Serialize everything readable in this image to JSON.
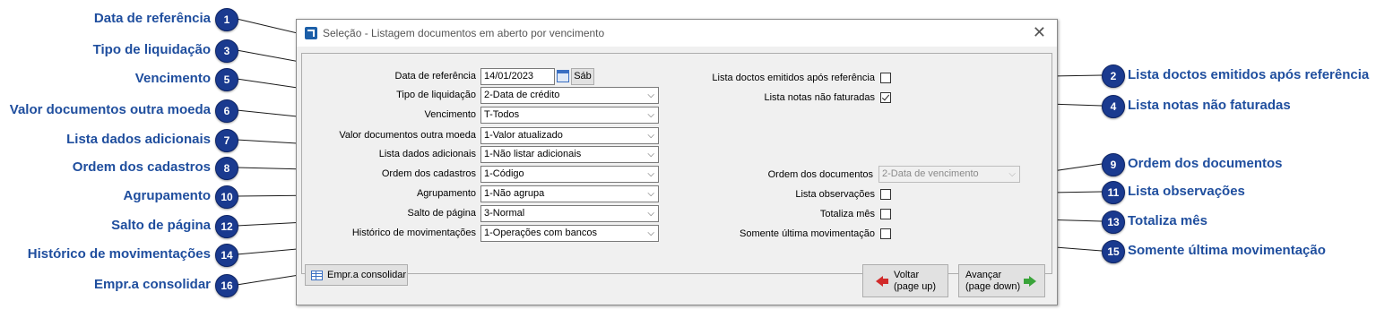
{
  "window": {
    "title": "Seleção - Listagem documentos em aberto por vencimento",
    "close_glyph": "✕"
  },
  "fields": {
    "data_referencia": {
      "label": "Data de referência",
      "value": "14/01/2023",
      "day_button": "Sáb"
    },
    "tipo_liquidacao": {
      "label": "Tipo de liquidação",
      "value": "2-Data de crédito"
    },
    "vencimento": {
      "label": "Vencimento",
      "value": "T-Todos"
    },
    "valor_outra_moeda": {
      "label": "Valor documentos outra moeda",
      "value": "1-Valor atualizado"
    },
    "lista_dados_adicionais": {
      "label": "Lista dados adicionais",
      "value": "1-Não listar adicionais"
    },
    "ordem_cadastros": {
      "label": "Ordem dos cadastros",
      "value": "1-Código"
    },
    "agrupamento": {
      "label": "Agrupamento",
      "value": "1-Não agrupa"
    },
    "salto_pagina": {
      "label": "Salto de página",
      "value": "3-Normal"
    },
    "historico_movimentacoes": {
      "label": "Histórico de movimentações",
      "value": "1-Operações com bancos"
    },
    "lista_doctos_emitidos": {
      "label": "Lista doctos emitidos após referência",
      "checked": false
    },
    "lista_notas_nao_faturadas": {
      "label": "Lista notas não faturadas",
      "checked": true
    },
    "ordem_documentos": {
      "label": "Ordem dos documentos",
      "value": "2-Data de vencimento",
      "disabled": true
    },
    "lista_observacoes": {
      "label": "Lista observações",
      "checked": false
    },
    "totaliza_mes": {
      "label": "Totaliza mês",
      "checked": false
    },
    "somente_ultima_mov": {
      "label": "Somente última movimentação",
      "checked": false
    }
  },
  "buttons": {
    "empr_consolidar": "Empr.a consolidar",
    "voltar_line1": "Voltar",
    "voltar_line2": "(page up)",
    "avancar_line1": "Avançar",
    "avancar_line2": "(page down)"
  },
  "callouts": [
    {
      "num": "1",
      "text": "Data de referência"
    },
    {
      "num": "2",
      "text": "Lista doctos emitidos após referência"
    },
    {
      "num": "3",
      "text": "Tipo de liquidação"
    },
    {
      "num": "4",
      "text": "Lista notas não faturadas"
    },
    {
      "num": "5",
      "text": "Vencimento"
    },
    {
      "num": "6",
      "text": "Valor documentos outra moeda"
    },
    {
      "num": "7",
      "text": "Lista dados adicionais"
    },
    {
      "num": "8",
      "text": "Ordem dos cadastros"
    },
    {
      "num": "9",
      "text": "Ordem dos documentos"
    },
    {
      "num": "10",
      "text": "Agrupamento"
    },
    {
      "num": "11",
      "text": "Lista observações"
    },
    {
      "num": "12",
      "text": "Salto de página"
    },
    {
      "num": "13",
      "text": "Totaliza mês"
    },
    {
      "num": "14",
      "text": "Histórico de movimentações"
    },
    {
      "num": "15",
      "text": "Somente última movimentação"
    },
    {
      "num": "16",
      "text": "Empr.a consolidar"
    }
  ],
  "colors": {
    "callout_text": "#1f4e9e",
    "badge": "#1a3a8f"
  }
}
